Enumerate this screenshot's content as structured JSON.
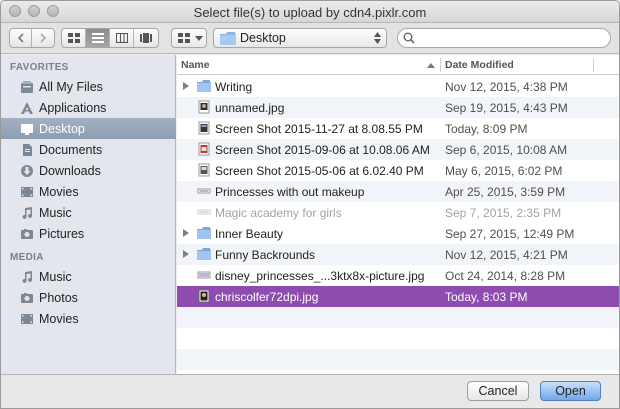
{
  "window": {
    "title": "Select file(s) to upload by cdn4.pixlr.com"
  },
  "toolbar": {
    "location": "Desktop",
    "search": {
      "value": "",
      "placeholder": ""
    }
  },
  "sidebar": {
    "favorites_label": "FAVORITES",
    "favorites": [
      {
        "label": "All My Files",
        "icon": "all-files-icon"
      },
      {
        "label": "Applications",
        "icon": "applications-icon"
      },
      {
        "label": "Desktop",
        "icon": "desktop-icon",
        "selected": true
      },
      {
        "label": "Documents",
        "icon": "documents-icon"
      },
      {
        "label": "Downloads",
        "icon": "downloads-icon"
      },
      {
        "label": "Movies",
        "icon": "movies-icon"
      },
      {
        "label": "Music",
        "icon": "music-icon"
      },
      {
        "label": "Pictures",
        "icon": "pictures-icon"
      }
    ],
    "media_label": "MEDIA",
    "media": [
      {
        "label": "Music",
        "icon": "music-icon"
      },
      {
        "label": "Photos",
        "icon": "photos-icon"
      },
      {
        "label": "Movies",
        "icon": "movies-icon"
      }
    ]
  },
  "file_list": {
    "columns": [
      "Name",
      "Date Modified"
    ],
    "rows": [
      {
        "name": "Writing",
        "date": "Nov 12, 2015, 4:38 PM",
        "kind": "folder"
      },
      {
        "name": "unnamed.jpg",
        "date": "Sep 19, 2015, 4:43 PM",
        "kind": "image"
      },
      {
        "name": "Screen Shot 2015-11-27 at 8.08.55 PM",
        "date": "Today, 8:09 PM",
        "kind": "screenshot"
      },
      {
        "name": "Screen Shot 2015-09-06 at 10.08.06 AM",
        "date": "Sep 6, 2015, 10:08 AM",
        "kind": "screenshot"
      },
      {
        "name": "Screen Shot 2015-05-06 at 6.02.40 PM",
        "date": "May 6, 2015, 6:02 PM",
        "kind": "screenshot"
      },
      {
        "name": "Princesses with out makeup",
        "date": "Apr 25, 2015, 3:59 PM",
        "kind": "document"
      },
      {
        "name": "Magic academy for girls",
        "date": "Sep 7, 2015, 2:35 PM",
        "kind": "document-disabled"
      },
      {
        "name": "Inner Beauty",
        "date": "Sep 27, 2015, 12:49 PM",
        "kind": "folder"
      },
      {
        "name": "Funny Backrounds",
        "date": "Nov 12, 2015, 4:21 PM",
        "kind": "folder"
      },
      {
        "name": "disney_princesses_...3ktx8x-picture.jpg",
        "date": "Oct 24, 2014, 8:28 PM",
        "kind": "image"
      },
      {
        "name": "chriscolfer72dpi.jpg",
        "date": "Today, 8:03 PM",
        "kind": "image",
        "selected": true
      }
    ]
  },
  "buttons": {
    "cancel": "Cancel",
    "open": "Open"
  },
  "colors": {
    "selection": "#8e4cb0",
    "sidebar_selection": "#97a4b8",
    "folder": "#8fb5e6",
    "primary_button": "#6fa8ea"
  }
}
